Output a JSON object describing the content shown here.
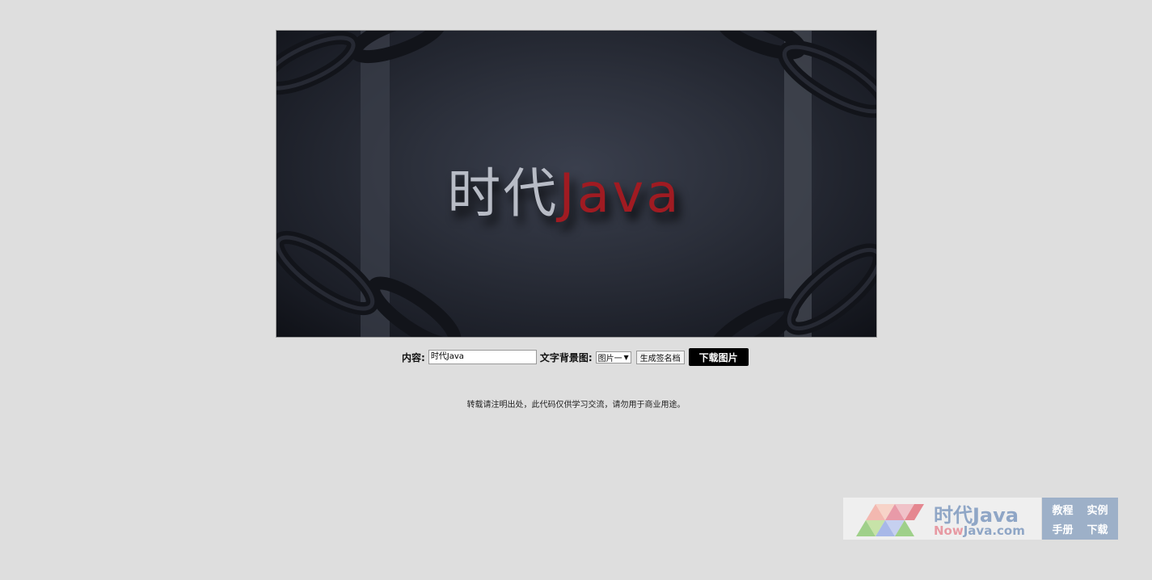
{
  "poster": {
    "title_part1": "时代",
    "title_part2": "Java"
  },
  "controls": {
    "content_label": "内容:",
    "content_value": "时代Java",
    "bg_label": "文字背景图:",
    "bg_selected": "图片一",
    "generate_label": "生成签名档",
    "download_label": "下载图片"
  },
  "notice": "转载请注明出处，此代码仅供学习交流，请勿用于商业用途。",
  "watermark": {
    "title": "时代Java",
    "url_highlight": "Now",
    "url_rest": "Java.com",
    "links": [
      "教程",
      "实例",
      "手册",
      "下载"
    ]
  },
  "colors": {
    "page_bg": "#dedede",
    "title_red": "#a01b22",
    "title_grey": "#b8bcc6",
    "download_bg": "#000000",
    "watermark_blue": "#9db0c8",
    "watermark_pink": "#e79aa3"
  }
}
